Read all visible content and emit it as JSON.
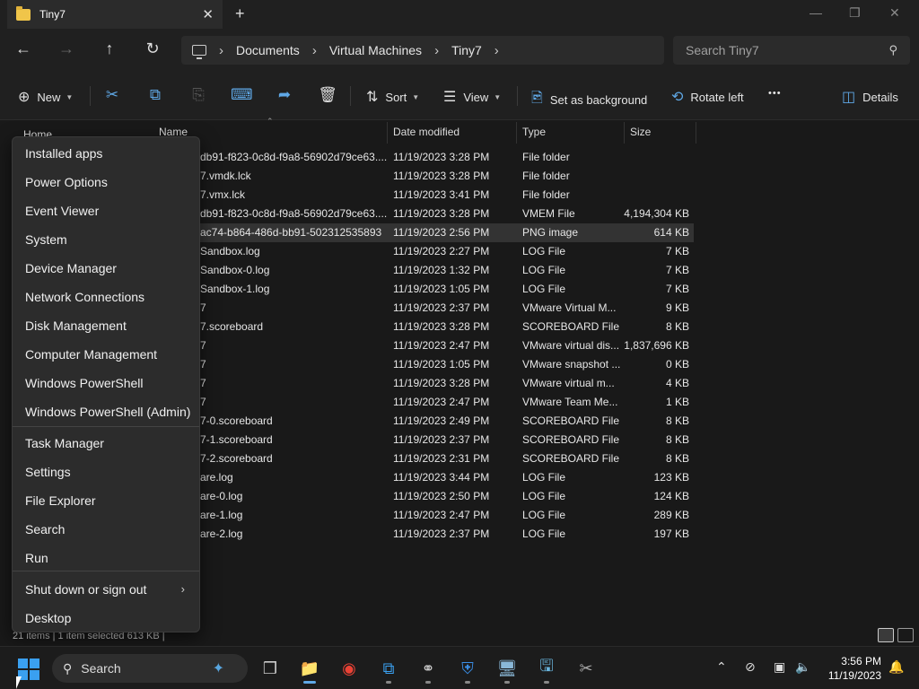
{
  "window": {
    "tab_title": "Tiny7",
    "close_tab": "✕",
    "new_tab": "+",
    "minimize": "—",
    "maximize": "❐",
    "close": "✕"
  },
  "nav": {
    "back": "←",
    "forward": "→",
    "up": "↑",
    "refresh": "↻",
    "breadcrumbs": [
      "Documents",
      "Virtual Machines",
      "Tiny7"
    ],
    "sep": "›",
    "search_placeholder": "Search Tiny7"
  },
  "toolbar": {
    "new_label": "New",
    "sort_label": "Sort",
    "view_label": "View",
    "set_background_label": "Set as background",
    "rotate_left_label": "Rotate left",
    "more_label": "•••",
    "details_label": "Details"
  },
  "sidebar": {
    "home_label": "Home"
  },
  "columns": {
    "name": "Name",
    "date": "Date modified",
    "type": "Type",
    "size": "Size"
  },
  "files": [
    {
      "name": "db91-f823-0c8d-f9a8-56902d79ce63....",
      "date": "11/19/2023 3:28 PM",
      "type": "File folder",
      "size": ""
    },
    {
      "name": "7.vmdk.lck",
      "date": "11/19/2023 3:28 PM",
      "type": "File folder",
      "size": ""
    },
    {
      "name": "7.vmx.lck",
      "date": "11/19/2023 3:41 PM",
      "type": "File folder",
      "size": ""
    },
    {
      "name": "db91-f823-0c8d-f9a8-56902d79ce63....",
      "date": "11/19/2023 3:28 PM",
      "type": "VMEM File",
      "size": "4,194,304 KB"
    },
    {
      "name": "ac74-b864-486d-bb91-502312535893",
      "date": "11/19/2023 2:56 PM",
      "type": "PNG image",
      "size": "614 KB"
    },
    {
      "name": "Sandbox.log",
      "date": "11/19/2023 2:27 PM",
      "type": "LOG File",
      "size": "7 KB"
    },
    {
      "name": "Sandbox-0.log",
      "date": "11/19/2023 1:32 PM",
      "type": "LOG File",
      "size": "7 KB"
    },
    {
      "name": "Sandbox-1.log",
      "date": "11/19/2023 1:05 PM",
      "type": "LOG File",
      "size": "7 KB"
    },
    {
      "name": "7",
      "date": "11/19/2023 2:37 PM",
      "type": "VMware Virtual M...",
      "size": "9 KB"
    },
    {
      "name": "7.scoreboard",
      "date": "11/19/2023 3:28 PM",
      "type": "SCOREBOARD File",
      "size": "8 KB"
    },
    {
      "name": "7",
      "date": "11/19/2023 2:47 PM",
      "type": "VMware virtual dis...",
      "size": "1,837,696 KB"
    },
    {
      "name": "7",
      "date": "11/19/2023 1:05 PM",
      "type": "VMware snapshot ...",
      "size": "0 KB"
    },
    {
      "name": "7",
      "date": "11/19/2023 3:28 PM",
      "type": "VMware virtual m...",
      "size": "4 KB"
    },
    {
      "name": "7",
      "date": "11/19/2023 2:47 PM",
      "type": "VMware Team Me...",
      "size": "1 KB"
    },
    {
      "name": "7-0.scoreboard",
      "date": "11/19/2023 2:49 PM",
      "type": "SCOREBOARD File",
      "size": "8 KB"
    },
    {
      "name": "7-1.scoreboard",
      "date": "11/19/2023 2:37 PM",
      "type": "SCOREBOARD File",
      "size": "8 KB"
    },
    {
      "name": "7-2.scoreboard",
      "date": "11/19/2023 2:31 PM",
      "type": "SCOREBOARD File",
      "size": "8 KB"
    },
    {
      "name": "are.log",
      "date": "11/19/2023 3:44 PM",
      "type": "LOG File",
      "size": "123 KB"
    },
    {
      "name": "are-0.log",
      "date": "11/19/2023 2:50 PM",
      "type": "LOG File",
      "size": "124 KB"
    },
    {
      "name": "are-1.log",
      "date": "11/19/2023 2:47 PM",
      "type": "LOG File",
      "size": "289 KB"
    },
    {
      "name": "are-2.log",
      "date": "11/19/2023 2:37 PM",
      "type": "LOG File",
      "size": "197 KB"
    }
  ],
  "status": {
    "text": "21 items  |  1 item selected  613 KB  |"
  },
  "context_menu": {
    "items": [
      "Installed apps",
      "Power Options",
      "Event Viewer",
      "System",
      "Device Manager",
      "Network Connections",
      "Disk Management",
      "Computer Management",
      "Windows PowerShell",
      "Windows PowerShell (Admin)",
      "Task Manager",
      "Settings",
      "File Explorer",
      "Search",
      "Run",
      "Shut down or sign out",
      "Desktop"
    ],
    "submenu_arrow": "›"
  },
  "taskbar": {
    "search_label": "Search",
    "clock_time": "3:56 PM",
    "clock_date": "11/19/2023"
  },
  "colors": {
    "accent": "#3aa0f0",
    "folder": "#f0c54a",
    "selected_row": "#333333",
    "menu_bg": "#2c2c2c"
  }
}
